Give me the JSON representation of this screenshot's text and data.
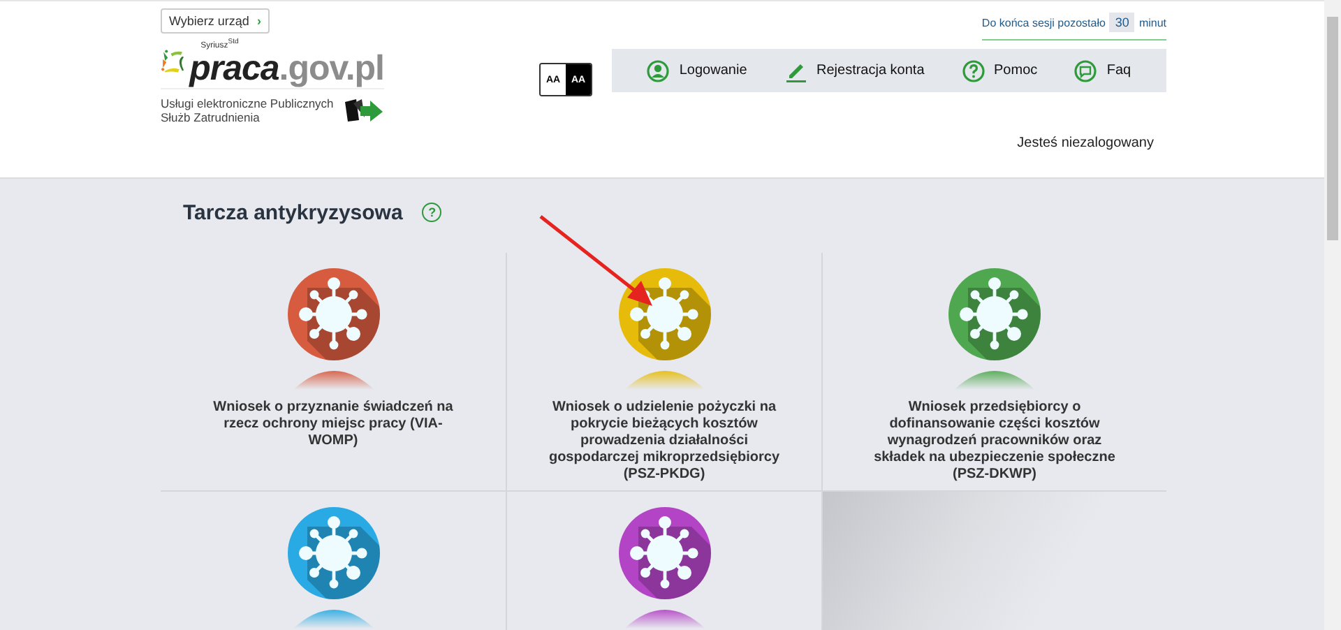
{
  "header": {
    "office_button": "Wybierz urząd",
    "office_button_arrow": "›",
    "logo": {
      "tagline": "Syriusz$^{Std}$",
      "name_main": "praca",
      "name_domain": ".gov.pl"
    },
    "subtitle": "Usługi elektroniczne Publicznych Służb Zatrudnienia",
    "contrast": [
      {
        "label": "AA",
        "selected": false
      },
      {
        "label": "AA",
        "selected": true
      }
    ],
    "session": {
      "prefix": "Do końca sesji pozostało",
      "minutes": "30",
      "suffix": "minut"
    },
    "nav": [
      {
        "label": "Logowanie",
        "kind": "user"
      },
      {
        "label": "Rejestracja konta",
        "kind": "pencil"
      },
      {
        "label": "Pomoc",
        "kind": "help"
      },
      {
        "label": "Faq",
        "kind": "chat"
      }
    ],
    "login_status": "Jesteś niezalogowany"
  },
  "section": {
    "title": "Tarcza antykryzysowa",
    "help": "?"
  },
  "tiles": [
    {
      "title": "Wniosek o przyznanie świadczeń na rzecz ochrony miejsc pracy (VIA-WOMP)",
      "color": "#d65b3f"
    },
    {
      "title": "Wniosek o udzielenie pożyczki na pokrycie bieżących kosztów prowadzenia działalności gospodarczej mikroprzedsiębiorcy (PSZ-PKDG)",
      "color": "#e6bb0a"
    },
    {
      "title": "Wniosek przedsiębiorcy o dofinansowanie części kosztów wynagrodzeń pracowników oraz składek na ubezpieczenie społeczne (PSZ-DKWP)",
      "color": "#4fa84f"
    },
    {
      "color": "#2aaae4"
    },
    {
      "color": "#b444c6"
    }
  ]
}
